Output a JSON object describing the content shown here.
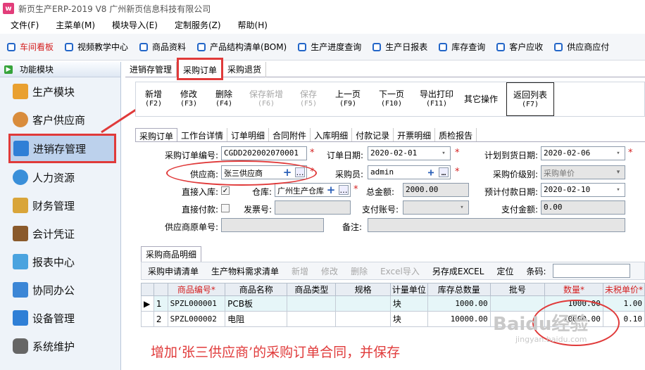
{
  "title": "新页生产ERP-2019 V8 广州新页信息科技有限公司",
  "menu": [
    "文件(F)",
    "主菜单(M)",
    "模块导入(E)",
    "定制服务(Z)",
    "帮助(H)"
  ],
  "quick": [
    "车间看板",
    "视频教学中心",
    "商品资料",
    "产品结构清单(BOM)",
    "生产进度查询",
    "生产日报表",
    "库存查询",
    "客户应收",
    "供应商应付"
  ],
  "sidebar": {
    "header": "功能模块",
    "items": [
      "生产模块",
      "客户供应商",
      "进销存管理",
      "人力资源",
      "财务管理",
      "会计凭证",
      "报表中心",
      "协同办公",
      "设备管理",
      "系统维护"
    ]
  },
  "tabs": [
    "进销存管理",
    "采购订单",
    "采购退货"
  ],
  "toolbar": [
    [
      "新增",
      "(F2)"
    ],
    [
      "修改",
      "(F3)"
    ],
    [
      "删除",
      "(F4)"
    ],
    [
      "保存新增",
      "(F6)"
    ],
    [
      "保存",
      "(F5)"
    ],
    [
      "上一页",
      "(F9)"
    ],
    [
      "下一页",
      "(F10)"
    ],
    [
      "导出打印",
      "(F11)"
    ],
    [
      "其它操作",
      ""
    ],
    [
      "返回列表",
      "(F7)"
    ]
  ],
  "subtabs": [
    "采购订单",
    "工作台详情",
    "订单明细",
    "合同附件",
    "入库明细",
    "付款记录",
    "开票明细",
    "质检报告"
  ],
  "form": {
    "order_no_label": "采购订单编号:",
    "order_no": "CGDD202002070001",
    "order_date_label": "订单日期:",
    "order_date": "2020-02-01",
    "plan_date_label": "计划到货日期:",
    "plan_date": "2020-02-06",
    "supplier_label": "供应商:",
    "supplier": "张三供应商",
    "buyer_label": "采购员:",
    "buyer": "admin",
    "price_level_label": "采购价级别:",
    "price_level": "采购单价",
    "direct_in_label": "直接入库:",
    "warehouse_label": "仓库:",
    "warehouse": "广州生产仓库",
    "total_label": "总金额:",
    "total": "2000.00",
    "pay_date_label": "预计付款日期:",
    "pay_date": "2020-02-10",
    "direct_pay_label": "直接付款:",
    "invoice_label": "发票号:",
    "pay_acct_label": "支付账号:",
    "pay_amt_label": "支付金额:",
    "pay_amt": "0.00",
    "src_label": "供应商原单号:",
    "remark_label": "备注:"
  },
  "grid": {
    "tab": "采购商品明细",
    "tools": [
      "采购申请清单",
      "生产物料需求清单",
      "新增",
      "修改",
      "删除",
      "Excel导入",
      "另存成EXCEL",
      "定位",
      "条码:"
    ],
    "headers": [
      "商品编号*",
      "商品名称",
      "商品类型",
      "规格",
      "计量单位",
      "库存总数量",
      "批号",
      "数量*",
      "未税单价*"
    ],
    "rows": [
      [
        "1",
        "SPZL000001",
        "PCB板",
        "",
        "",
        "块",
        "1000.00",
        "",
        "1000.00",
        "1.00"
      ],
      [
        "2",
        "SPZL000002",
        "电阻",
        "",
        "",
        "块",
        "10000.00",
        "",
        "10000.00",
        "0.10"
      ]
    ]
  },
  "annotation": "增加‘张三供应商’的采购订单合同，并保存",
  "watermark": "Baidu经验",
  "watermark_url": "jingyan.baidu.com"
}
